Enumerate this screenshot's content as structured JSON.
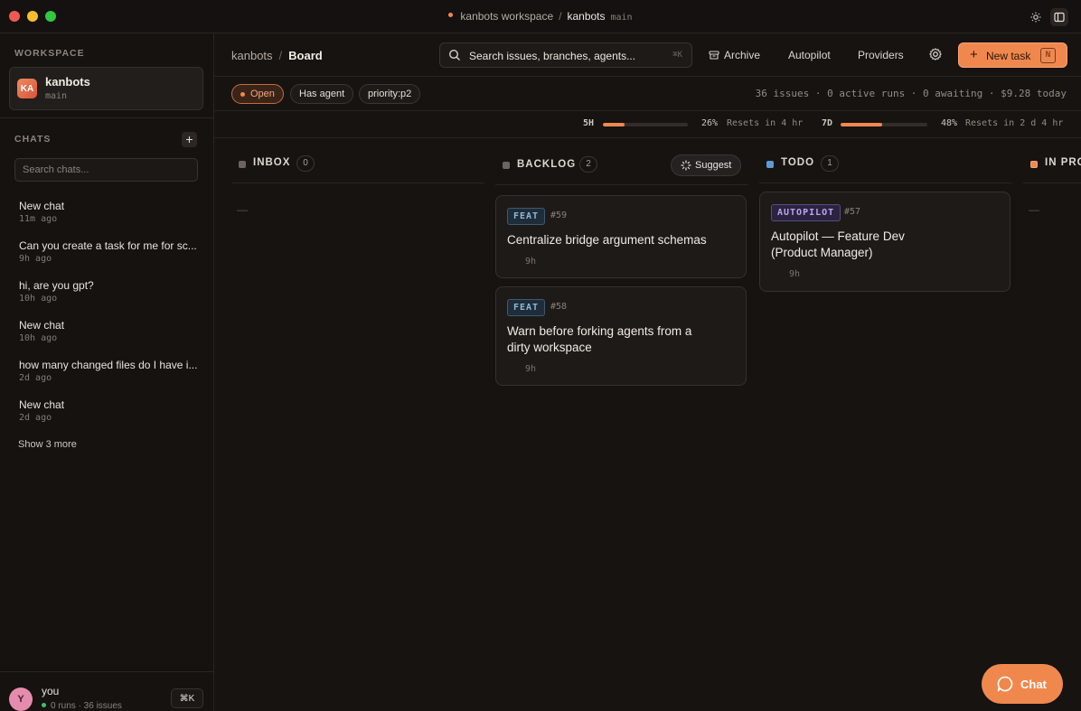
{
  "titlebar": {
    "workspace": "kanbots workspace",
    "project": "kanbots",
    "branch": "main"
  },
  "sidebar": {
    "workspace_label": "WORKSPACE",
    "workspace": {
      "initials": "KA",
      "name": "kanbots",
      "branch": "main"
    },
    "chats_label": "CHATS",
    "add_label": "+",
    "search_placeholder": "Search chats...",
    "chats": [
      {
        "title": "New chat",
        "time": "11m ago"
      },
      {
        "title": "Can you create a task for me for sc...",
        "time": "9h ago"
      },
      {
        "title": "hi, are you gpt?",
        "time": "10h ago"
      },
      {
        "title": "New chat",
        "time": "10h ago"
      },
      {
        "title": "how many changed files do I have i...",
        "time": "2d ago"
      },
      {
        "title": "New chat",
        "time": "2d ago"
      }
    ],
    "show_more": "Show 3 more",
    "user": {
      "initial": "Y",
      "name": "you",
      "stats": "0 runs · 36 issues",
      "shortcut": "⌘K"
    }
  },
  "header": {
    "crumb_root": "kanbots",
    "crumb_sep": "/",
    "crumb_current": "Board",
    "search_text": "Search issues, branches, agents...",
    "search_kbd": "⌘K",
    "archive": "Archive",
    "autopilot": "Autopilot",
    "providers": "Providers",
    "new_task": "New task",
    "new_task_kbd": "N"
  },
  "filters": {
    "chips": [
      "Open",
      "Has agent",
      "priority:p2"
    ],
    "stats": "36 issues · 0 active runs · 0 awaiting · $9.28 today"
  },
  "usage": {
    "five_h": {
      "label": "5H",
      "percent_label": "26%",
      "value": 0.26,
      "reset": "Resets in 4 hr"
    },
    "seven_d": {
      "label": "7D",
      "percent_label": "48%",
      "value": 0.48,
      "reset": "Resets in 2 d 4 hr"
    }
  },
  "columns": [
    {
      "title": "INBOX",
      "count": "0",
      "empty": "—",
      "color": "#6b6460"
    },
    {
      "title": "BACKLOG",
      "count": "2",
      "suggest": "Suggest",
      "color": "#6b6460"
    },
    {
      "title": "TODO",
      "count": "1",
      "color": "#5b9bd5"
    },
    {
      "title": "IN PROGRESS",
      "visible_text": "IN PRO",
      "empty": "—",
      "color": "#f0884e"
    }
  ],
  "cards": {
    "c59": {
      "tag": "FEAT",
      "id": "#59",
      "title": "Centralize bridge argument schemas",
      "time": "9h"
    },
    "c58": {
      "tag": "FEAT",
      "id": "#58",
      "title_line1": "Warn before forking agents from a",
      "title_line2": "dirty workspace",
      "time": "9h"
    },
    "c57": {
      "tag": "AUTOPILOT",
      "id": "#57",
      "title_line1": "Autopilot — Feature Dev",
      "title_line2": "(Product Manager)",
      "time": "9h"
    }
  },
  "chat_fab": "Chat",
  "colors": {
    "accent": "#f0884e",
    "background": "#161311"
  }
}
